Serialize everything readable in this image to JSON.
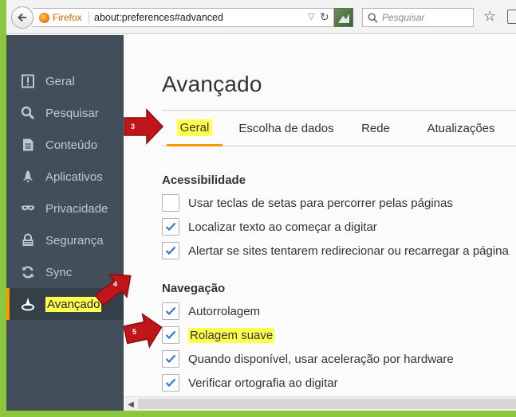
{
  "browser": {
    "identity_label": "Firefox",
    "url": "about:preferences#advanced",
    "search_placeholder": "Pesquisar"
  },
  "sidebar": {
    "items": [
      {
        "label": "Geral",
        "icon": "general-icon"
      },
      {
        "label": "Pesquisar",
        "icon": "search-icon"
      },
      {
        "label": "Conteúdo",
        "icon": "content-icon"
      },
      {
        "label": "Aplicativos",
        "icon": "applications-icon"
      },
      {
        "label": "Privacidade",
        "icon": "privacy-mask-icon"
      },
      {
        "label": "Segurança",
        "icon": "security-lock-icon"
      },
      {
        "label": "Sync",
        "icon": "sync-icon"
      },
      {
        "label": "Avançado",
        "icon": "advanced-wizard-icon",
        "active": true
      }
    ]
  },
  "main": {
    "title": "Avançado",
    "tabs": [
      {
        "label": "Geral",
        "active": true
      },
      {
        "label": "Escolha de dados"
      },
      {
        "label": "Rede"
      },
      {
        "label": "Atualizações"
      }
    ],
    "sections": [
      {
        "title": "Acessibilidade",
        "options": [
          {
            "label": "Usar teclas de setas para percorrer pelas páginas",
            "checked": false
          },
          {
            "label": "Localizar texto ao começar a digitar",
            "checked": true
          },
          {
            "label": "Alertar se sites tentarem redirecionar ou recarregar a página",
            "checked": true
          }
        ]
      },
      {
        "title": "Navegação",
        "options": [
          {
            "label": "Autorrolagem",
            "checked": true
          },
          {
            "label": "Rolagem suave",
            "checked": true,
            "highlighted": true
          },
          {
            "label": "Quando disponível, usar aceleração por hardware",
            "checked": true
          },
          {
            "label": "Verificar ortografia ao digitar",
            "checked": true
          }
        ]
      }
    ]
  },
  "annotations": [
    {
      "number": "3"
    },
    {
      "number": "4"
    },
    {
      "number": "5"
    }
  ],
  "colors": {
    "highlight": "#ffff4d",
    "accent": "#ff9500",
    "sidebar_bg": "#424f5a",
    "arrow_red": "#c0161a",
    "outer_green": "#8dc63f"
  }
}
